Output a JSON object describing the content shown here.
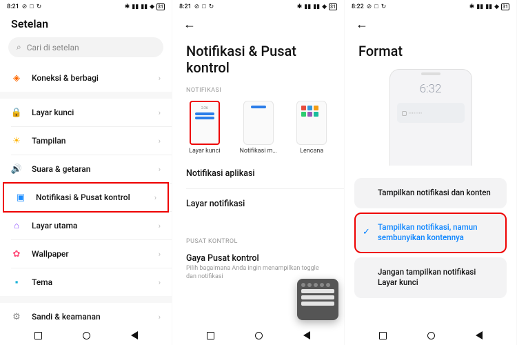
{
  "panel1": {
    "status": {
      "time": "8:21",
      "battery": "31"
    },
    "title": "Setelan",
    "search_placeholder": "Cari di setelan",
    "rows": [
      {
        "icon": "🔗",
        "label": "Koneksi & berbagi",
        "color": "#ff6a00"
      },
      {
        "icon": "🔒",
        "label": "Layar kunci",
        "color": "#ff4d4d"
      },
      {
        "icon": "☀",
        "label": "Tampilan",
        "color": "#ffb300"
      },
      {
        "icon": "🔊",
        "label": "Suara & getaran",
        "color": "#1bbf4c"
      },
      {
        "icon": "▣",
        "label": "Notifikasi & Pusat kontrol",
        "color": "#1a8cff",
        "highlight": true
      },
      {
        "icon": "⌂",
        "label": "Layar utama",
        "color": "#8a4dff"
      },
      {
        "icon": "✿",
        "label": "Wallpaper",
        "color": "#ff4d7a"
      },
      {
        "icon": "▪",
        "label": "Tema",
        "color": "#1ab2d8"
      },
      {
        "icon": "⚙",
        "label": "Sandi & keamanan",
        "color": "#888"
      }
    ]
  },
  "panel2": {
    "status": {
      "time": "8:21",
      "battery": "31"
    },
    "title": "Notifikasi & Pusat kontrol",
    "section_notif": "NOTIFIKASI",
    "thumbs": [
      {
        "label": "Layar kunci",
        "highlight": true
      },
      {
        "label": "Notifikasi m…"
      },
      {
        "label": "Lencana"
      }
    ],
    "thumb_time": "2:36",
    "rows": [
      {
        "label": "Notifikasi aplikasi"
      },
      {
        "label": "Layar notifikasi"
      }
    ],
    "section_ctrl": "PUSAT KONTROL",
    "ctrl_title": "Gaya Pusat kontrol",
    "ctrl_sub": "Pilih bagaimana Anda ingin menampilkan toggle dan notifikasi"
  },
  "panel3": {
    "status": {
      "time": "8:22",
      "battery": "31"
    },
    "title": "Format",
    "preview_time": "6:32",
    "options": [
      {
        "label": "Tampilkan notifikasi dan konten"
      },
      {
        "label": "Tampilkan notifikasi, namun sembunyikan kontennya",
        "selected": true,
        "highlight": true
      },
      {
        "label": "Jangan tampilkan notifikasi Layar kunci"
      }
    ]
  }
}
